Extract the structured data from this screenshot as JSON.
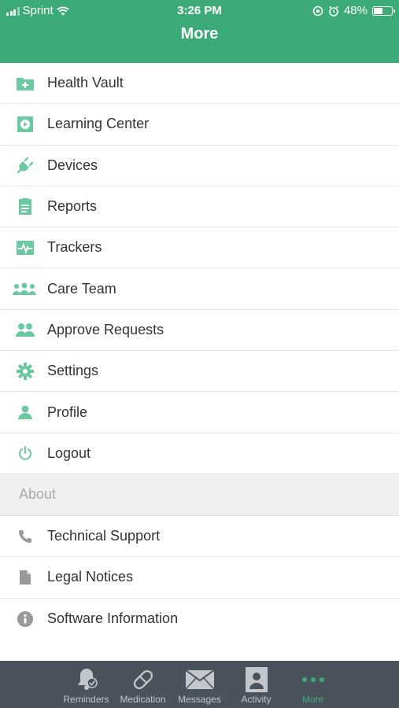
{
  "status_bar": {
    "carrier": "Sprint",
    "time": "3:26 PM",
    "battery": "48%",
    "battery_level": 0.48
  },
  "header": {
    "title": "More"
  },
  "menu": {
    "items": [
      {
        "label": "Health Vault",
        "icon": "health-vault-icon"
      },
      {
        "label": "Learning Center",
        "icon": "play-icon"
      },
      {
        "label": "Devices",
        "icon": "plug-icon"
      },
      {
        "label": "Reports",
        "icon": "report-icon"
      },
      {
        "label": "Trackers",
        "icon": "pulse-icon"
      },
      {
        "label": "Care Team",
        "icon": "team-icon"
      },
      {
        "label": "Approve Requests",
        "icon": "users-icon"
      },
      {
        "label": "Settings",
        "icon": "gear-icon"
      },
      {
        "label": "Profile",
        "icon": "person-icon"
      },
      {
        "label": "Logout",
        "icon": "power-icon"
      }
    ],
    "section_title": "About",
    "about_items": [
      {
        "label": "Technical Support",
        "icon": "phone-icon"
      },
      {
        "label": "Legal Notices",
        "icon": "document-icon"
      },
      {
        "label": "Software Information",
        "icon": "info-icon"
      }
    ]
  },
  "tabbar": {
    "tabs": [
      {
        "label": "Reminders",
        "icon": "bell-check-icon"
      },
      {
        "label": "Medication",
        "icon": "pill-icon"
      },
      {
        "label": "Messages",
        "icon": "envelope-icon"
      },
      {
        "label": "Activity",
        "icon": "badge-icon"
      },
      {
        "label": "More",
        "icon": "more-dots-icon",
        "active": true
      }
    ]
  },
  "colors": {
    "brand": "#3cab78",
    "tabbar": "#4a525c",
    "icon_gray": "#999999"
  }
}
